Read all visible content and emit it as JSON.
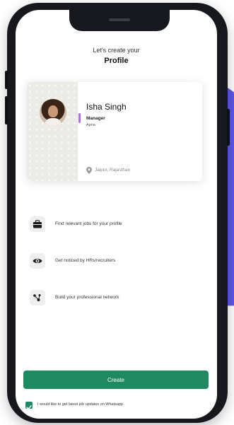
{
  "header": {
    "subtitle": "Let's create your",
    "title": "Profile"
  },
  "profile_card": {
    "name": "Isha Singh",
    "role": "Manager",
    "company": "Apna",
    "location": "Jaipur, Rajasthan"
  },
  "features": [
    {
      "icon": "briefcase-icon",
      "label": "Find relevant jobs for your profile"
    },
    {
      "icon": "eye-icon",
      "label": "Get noticed by HRs/recruiters"
    },
    {
      "icon": "network-icon",
      "label": "Build your professional network"
    }
  ],
  "create_button": {
    "label": "Create"
  },
  "whatsapp_optin": {
    "label": "I would like to get latest job updates on Whatsapp",
    "checked": true
  },
  "colors": {
    "primary_green": "#1f8a62",
    "background_accent": "#5d56f0",
    "phone_frame": "#16181d"
  }
}
